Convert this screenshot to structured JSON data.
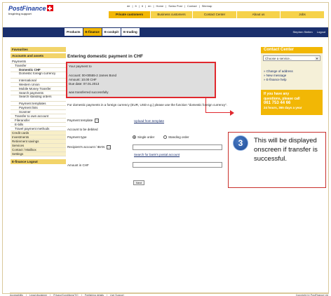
{
  "brand": {
    "logo_text": "PostFinance",
    "tagline": "Inspiring support"
  },
  "top_links": [
    "de",
    "fr",
    "it",
    "en",
    "Home",
    "Swiss Post",
    "Contact",
    "Sitemap"
  ],
  "main_tabs": [
    {
      "label": "Private customers",
      "active": true
    },
    {
      "label": "Business customers",
      "active": false
    },
    {
      "label": "Contact Center",
      "active": false
    },
    {
      "label": "About us",
      "active": false
    },
    {
      "label": "Jobs",
      "active": false
    }
  ],
  "sub_tabs": [
    {
      "label": "Products",
      "active": false
    },
    {
      "label": "E-finance",
      "active": true
    },
    {
      "label": "E-cockpit",
      "active": false
    },
    {
      "label": "E-trading",
      "active": false
    }
  ],
  "user": {
    "name": "Stephen Stellen",
    "logout": "Logout"
  },
  "sidebar": {
    "favourites": "Favourites",
    "accounts": "Accounts and assets",
    "items": [
      {
        "label": "Payments",
        "level": 0
      },
      {
        "label": "Transfer",
        "level": 1
      },
      {
        "label": "Domestic CHF",
        "level": 2,
        "selected": true
      },
      {
        "label": "Domestic foreign currency",
        "level": 2
      },
      {
        "label": "International",
        "level": 2
      },
      {
        "label": "Western Union",
        "level": 2
      },
      {
        "label": "Mobile Money Transfer",
        "level": 2
      },
      {
        "label": "Search payments",
        "level": 2
      },
      {
        "label": "Search standing orders",
        "level": 2
      },
      {
        "label": "Payment templates",
        "level": 2
      },
      {
        "label": "Payment lists",
        "level": 2
      },
      {
        "label": "Scanner",
        "level": 2
      },
      {
        "label": "Transfer to own account",
        "level": 1
      },
      {
        "label": "Fileransfer",
        "level": 1
      },
      {
        "label": "E-bills",
        "level": 1
      },
      {
        "label": "Travel payment methods",
        "level": 1
      },
      {
        "label": "Credit cards",
        "level": 0,
        "tint": true
      },
      {
        "label": "Investments",
        "level": 0,
        "tint": true
      },
      {
        "label": "Retirement savings",
        "level": 0,
        "tint": true
      },
      {
        "label": "Services",
        "level": 0,
        "tint": true
      },
      {
        "label": "Contact / Mailbox",
        "level": 0,
        "tint": true
      },
      {
        "label": "Settings",
        "level": 0,
        "tint": true
      }
    ],
    "logout": "E-finance Logout"
  },
  "main": {
    "title": "Entering domestic payment in CHF",
    "confirmation": {
      "line1": "Your payment to",
      "line2": "Account: 00-00555-2 James Bond",
      "line3": "Amount: 10.00 CHF",
      "line4": "Due date: 07.01.2013",
      "line5": "was transferred successfully"
    },
    "note": "For domestic payments in a foreign currency (EUR, USD e.g.) please use the function \"domestic foreign currency\".",
    "payment_template_label": "Payment template",
    "upload_template_link": "Upload from template",
    "account_debited_label": "Account to be debited",
    "payment_type_label": "Payment type",
    "single_order": "Single order",
    "standing_order": "Standing order",
    "recipient_label": "Recipient's account / IBAN",
    "search_bank_link": "Search for bank's postal account",
    "amount_label": "Amount in CHF",
    "info_glyph": "i",
    "next_button": "Next"
  },
  "contact": {
    "title": "Contact Center",
    "select_placeholder": "Choose a service...",
    "select_arrow": "▼",
    "links": [
      "Change of address",
      "New message",
      "E-finance help"
    ],
    "call_line1": "If you have any",
    "call_line2": "questions, please call",
    "phone": "061 753 44 66",
    "hours": "24 hours, 365 days a year"
  },
  "callout": {
    "number": "3",
    "text": "This will be displayed onscreen if transfer is successful."
  },
  "footer": {
    "links": [
      "Accessibility",
      "Legal disclaimer",
      "Privacy/Conditions/T/C",
      "Publishing details",
      "Live Support"
    ],
    "copyright": "Copyright (c) PostFinance Ltd"
  },
  "colors": {
    "brand_yellow": "#f2b705",
    "brand_blue": "#1a2f6c",
    "highlight_red": "#e0282e"
  }
}
